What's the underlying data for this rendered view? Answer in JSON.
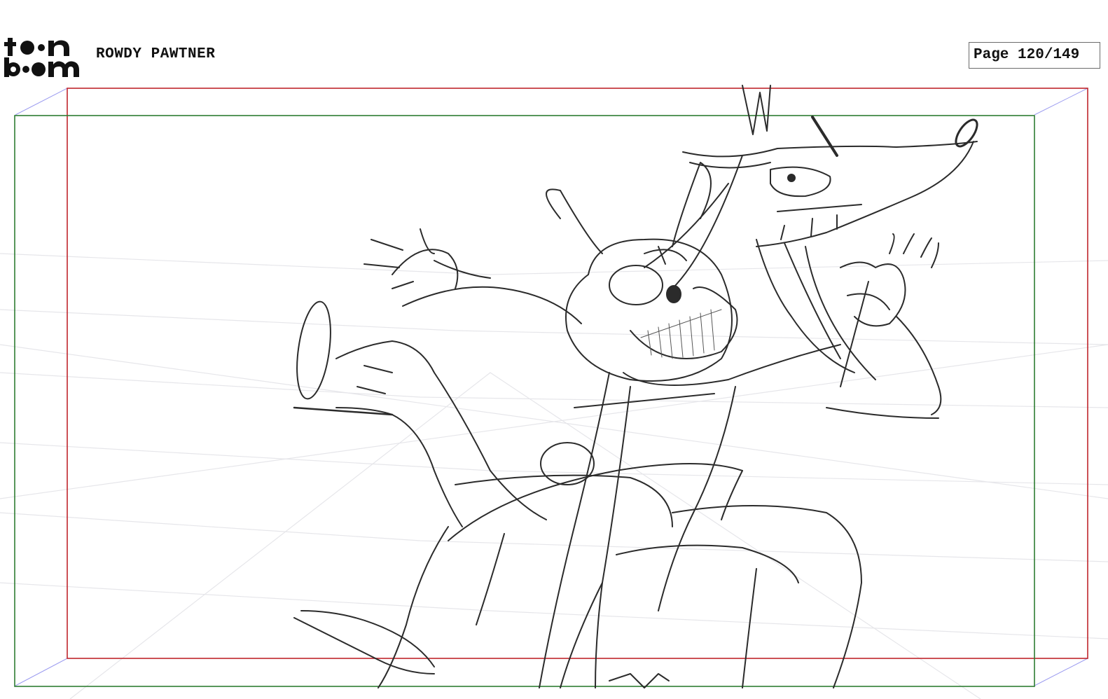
{
  "header": {
    "logo_text_top": "toon",
    "logo_text_bottom": "boom",
    "project_title": "ROWDY PAWTNER",
    "page_indicator": "Page 120/149"
  },
  "frames": {
    "camera_frame_color": "#c0262c",
    "safe_frame_color": "#2e7d32",
    "perspective_guide_color": "#8e8ee8"
  },
  "drawing": {
    "subject": "rough pencil storyboard sketch",
    "line_color": "#2b2b2b"
  }
}
